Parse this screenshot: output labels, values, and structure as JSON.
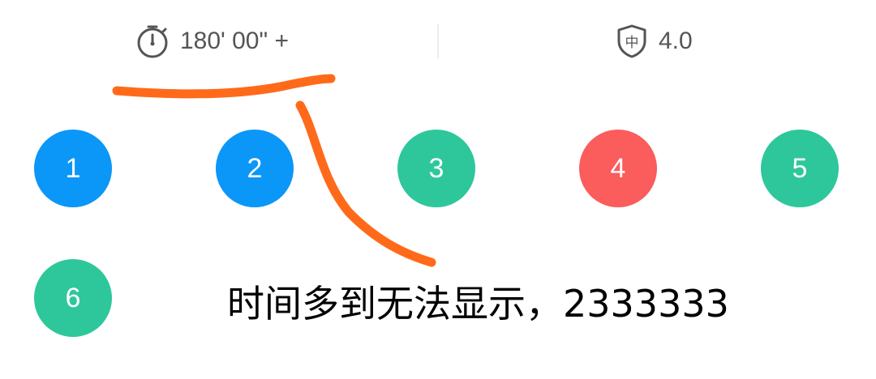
{
  "header": {
    "time_icon": "stopwatch-icon",
    "time_text": "180' 00\" +",
    "level_icon": "shield-zhong-icon",
    "level_icon_char": "中",
    "level_text": "4.0"
  },
  "questions": [
    {
      "label": "1",
      "status": "current",
      "color": "#0b97f7"
    },
    {
      "label": "2",
      "status": "current",
      "color": "#0b97f7"
    },
    {
      "label": "3",
      "status": "correct",
      "color": "#2ec79b"
    },
    {
      "label": "4",
      "status": "wrong",
      "color": "#fb5c5c"
    },
    {
      "label": "5",
      "status": "correct",
      "color": "#2ec79b"
    },
    {
      "label": "6",
      "status": "correct",
      "color": "#2ec79b"
    }
  ],
  "annotation": {
    "text": "时间多到无法显示，2333333",
    "stroke_color": "#ff6a1a"
  }
}
